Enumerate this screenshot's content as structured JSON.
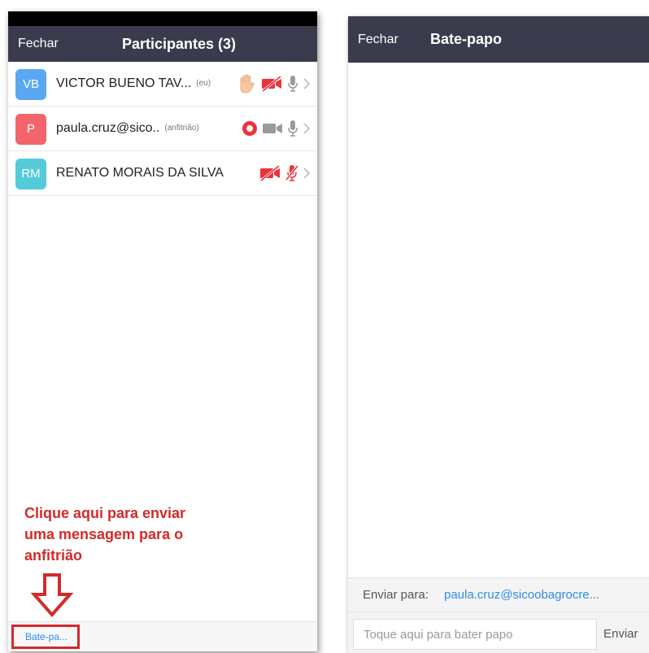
{
  "participants_panel": {
    "close_label": "Fechar",
    "title": "Participantes (3)",
    "participants": [
      {
        "initials": "VB",
        "avatar_color": "#5aa8f2",
        "name": "VICTOR BUENO TAV...",
        "role": "(eu)",
        "icons": [
          "raised-hand-icon",
          "video-off-icon",
          "mic-on-icon",
          "chevron-right-icon"
        ]
      },
      {
        "initials": "P",
        "avatar_color": "#f2656a",
        "name": "paula.cruz@sico..",
        "role": "(anfitrião)",
        "icons": [
          "recording-icon",
          "video-on-icon",
          "mic-on-icon",
          "chevron-right-icon"
        ]
      },
      {
        "initials": "RM",
        "avatar_color": "#56cbd8",
        "name": "RENATO MORAIS DA SILVA",
        "role": "",
        "icons": [
          "video-off-icon",
          "mic-muted-icon",
          "chevron-right-icon"
        ]
      }
    ],
    "annotation_lines": [
      "Clique aqui para enviar",
      "uma mensagem para o",
      "anfitrião"
    ],
    "chat_button_label": "Bate-pa..."
  },
  "chat_panel": {
    "close_label": "Fechar",
    "title": "Bate-papo",
    "recipient_label": "Enviar para:",
    "recipient_value": "paula.cruz@sicoobagrocre...",
    "input_placeholder": "Toque aqui para bater papo",
    "send_label": "Enviar"
  },
  "colors": {
    "header_bg": "#3a3c4d",
    "accent_blue": "#2d8cf0",
    "annotation_red": "#d32a2a",
    "muted_red": "#e8333c"
  }
}
